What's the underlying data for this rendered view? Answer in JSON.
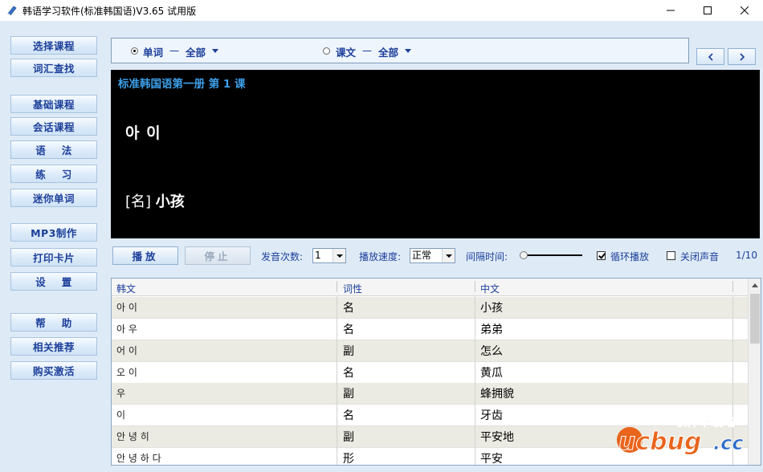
{
  "window": {
    "title": "韩语学习软件(标准韩国语)V3.65 试用版"
  },
  "sidebar": {
    "items": [
      {
        "label": "选择课程"
      },
      {
        "label": "词汇查找"
      },
      {
        "label": "基础课程"
      },
      {
        "label": "会话课程"
      },
      {
        "label": "语    法"
      },
      {
        "label": "练    习"
      },
      {
        "label": "迷你单词"
      },
      {
        "label": "MP3制作"
      },
      {
        "label": "打印卡片"
      },
      {
        "label": "设    置"
      },
      {
        "label": "帮    助"
      },
      {
        "label": "相关推荐"
      },
      {
        "label": "购买激活"
      }
    ]
  },
  "filter": {
    "word_label": "单词",
    "word_scope": "全部",
    "text_label": "课文",
    "text_scope": "全部",
    "dash": "一",
    "selected": "单词"
  },
  "display": {
    "lesson": "标准韩国语第一册 第 1 课",
    "korean": "아 이",
    "pos_tag": "[名]",
    "meaning": "小孩"
  },
  "controls": {
    "play_label": "播放",
    "stop_label": "停止",
    "repeat_label": "发音次数:",
    "repeat_value": "1",
    "speed_label": "播放速度:",
    "speed_value": "正常",
    "interval_label": "间隔时间:",
    "loop_label": "循环播放",
    "loop_checked": true,
    "mute_label": "关闭声音",
    "mute_checked": false,
    "page": "1/10"
  },
  "table": {
    "headers": [
      "韩文",
      "词性",
      "中文"
    ],
    "rows": [
      [
        "아 이",
        "名",
        "小孩"
      ],
      [
        "아 우",
        "名",
        "弟弟"
      ],
      [
        "어 이",
        "副",
        "怎么"
      ],
      [
        "오 이",
        "名",
        "黄瓜"
      ],
      [
        "우",
        "副",
        "蜂拥貌"
      ],
      [
        "이",
        "名",
        "牙齿"
      ],
      [
        "안 녕 히",
        "副",
        "平安地"
      ],
      [
        "안 녕 하 다",
        "形",
        "平安"
      ]
    ]
  },
  "watermark": {
    "line1": "软件下载站",
    "line2": "ucbug.cc"
  },
  "colors": {
    "accent": "#1c3f9a",
    "lesson_title": "#3d9fe8",
    "display_bg": "#000000",
    "window_bg": "#deebf7",
    "row_alt": "#ecebe3"
  }
}
